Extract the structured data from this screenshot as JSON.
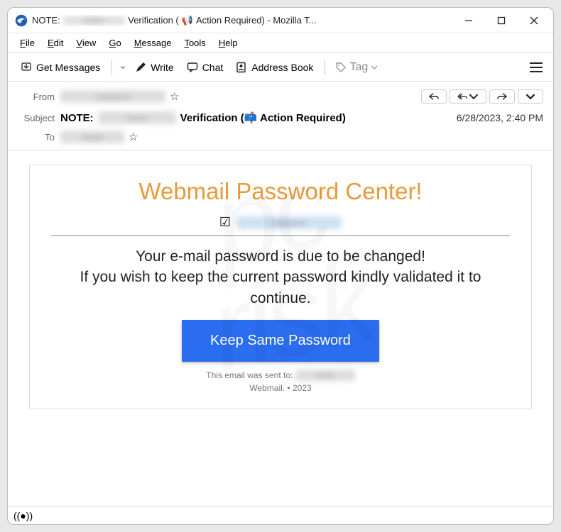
{
  "titlebar": {
    "prefix": "NOTE:",
    "mid": "Verification (",
    "action_icon_label": "📢",
    "action_text": " Action Required) - Mozilla T..."
  },
  "menubar": [
    "File",
    "Edit",
    "View",
    "Go",
    "Message",
    "Tools",
    "Help"
  ],
  "toolbar": {
    "get_messages": "Get Messages",
    "write": "Write",
    "chat": "Chat",
    "address_book": "Address Book",
    "tag": "Tag"
  },
  "headers": {
    "from_label": "From",
    "subject_label": "Subject",
    "to_label": "To",
    "subject_prefix": "NOTE:",
    "subject_mid": "Verification (",
    "subject_icon": "📫",
    "subject_action": " Action Required)",
    "timestamp": "6/28/2023, 2:40 PM"
  },
  "email": {
    "title": "Webmail Password Center!",
    "line1": "Your e-mail password is due to be changed!",
    "line2": "If you wish to keep the current password kindly validated it to continue.",
    "button": "Keep Same Password",
    "sent_to": "This email was sent to:",
    "footer": "Webmail. • 2023"
  }
}
